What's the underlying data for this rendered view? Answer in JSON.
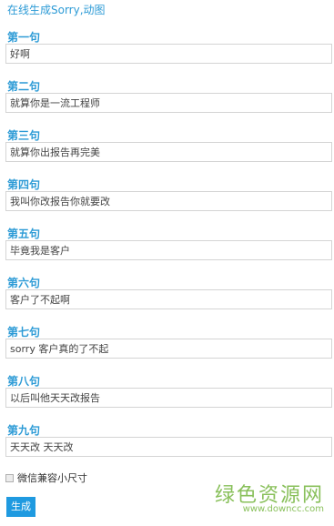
{
  "page": {
    "title": "在线生成Sorry,动图"
  },
  "lines": [
    {
      "label": "第一句",
      "value": "好啊"
    },
    {
      "label": "第二句",
      "value": "就算你是一流工程师"
    },
    {
      "label": "第三句",
      "value": "就算你出报告再完美"
    },
    {
      "label": "第四句",
      "value": "我叫你改报告你就要改"
    },
    {
      "label": "第五句",
      "value": "毕竟我是客户"
    },
    {
      "label": "第六句",
      "value": "客户了不起啊"
    },
    {
      "label": "第七句",
      "value": "sorry 客户真的了不起"
    },
    {
      "label": "第八句",
      "value": "以后叫他天天改报告"
    },
    {
      "label": "第九句",
      "value": "天天改 天天改"
    }
  ],
  "option": {
    "label": "微信兼容小尺寸",
    "checked": false
  },
  "submit": {
    "label": "生成"
  },
  "watermark": {
    "title": "绿色资源网",
    "url": "www.downcc.com"
  },
  "colors": {
    "accent": "#2d9bd6",
    "button": "#1f9ae0",
    "watermark": "#89c05b"
  }
}
